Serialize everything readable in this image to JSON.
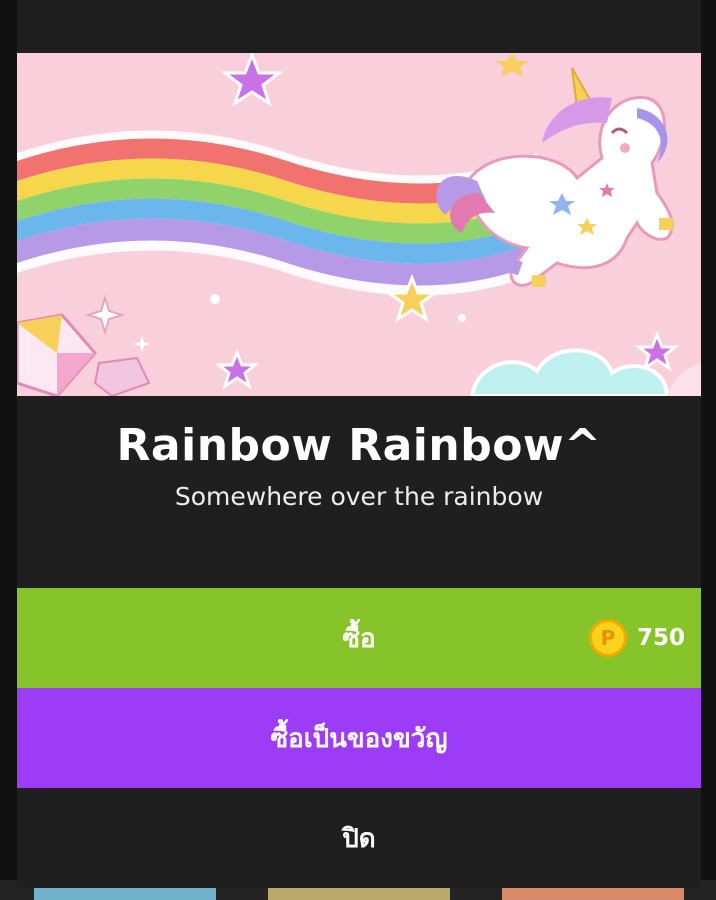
{
  "dialog": {
    "title": "Rainbow Rainbow^",
    "subtitle": "Somewhere over the rainbow"
  },
  "buttons": {
    "buy_label": "ซื้อ",
    "gift_label": "ซื้อเป็นของขวัญ",
    "close_label": "ปิด"
  },
  "price": {
    "currency_icon": "coin-icon",
    "currency_glyph": "P",
    "amount": "750"
  },
  "colors": {
    "buy": "#86c42a",
    "gift": "#9d3cf7",
    "background": "#1f1f1f",
    "coin": "#f9d21c"
  },
  "banner": {
    "image": "unicorn-rainbow-artwork"
  }
}
